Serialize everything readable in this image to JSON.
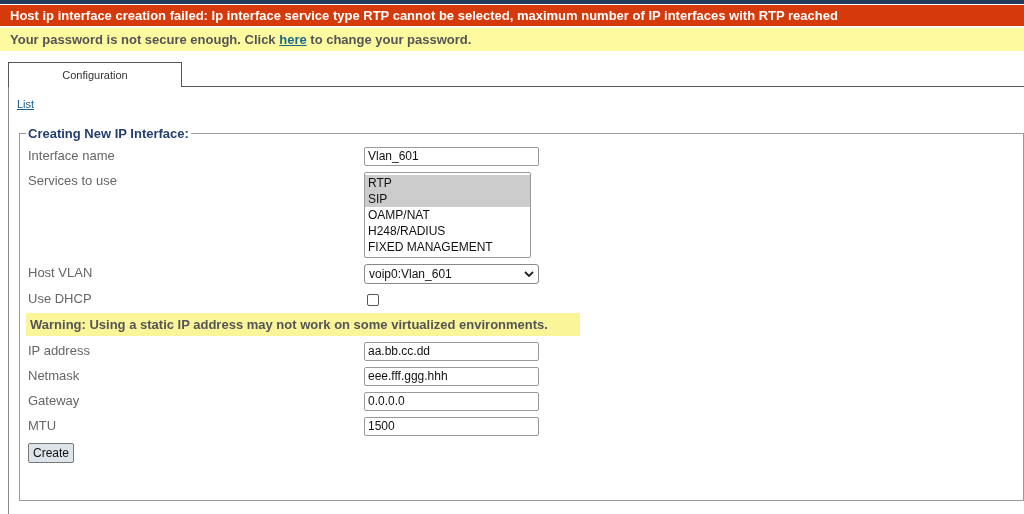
{
  "error_banner": "Host ip interface creation failed: Ip interface service type RTP cannot be selected, maximum number of IP interfaces with RTP reached",
  "password_notice": {
    "before": "Your password is not secure enough. Click ",
    "link": "here",
    "after": " to change your password."
  },
  "tabs": [
    {
      "label": "Configuration",
      "selected": true
    }
  ],
  "list_link": "List",
  "form": {
    "legend": "Creating New IP Interface:",
    "fields": [
      {
        "kind": "text",
        "label": "Interface name",
        "value": "Vlan_601"
      },
      {
        "kind": "listbox",
        "label": "Services to use",
        "options": [
          {
            "label": "RTP",
            "selected": true
          },
          {
            "label": "SIP",
            "selected": true
          },
          {
            "label": "OAMP/NAT",
            "selected": false
          },
          {
            "label": "H248/RADIUS",
            "selected": false
          },
          {
            "label": "FIXED MANAGEMENT",
            "selected": false
          }
        ]
      },
      {
        "kind": "select",
        "label": "Host VLAN",
        "value": "voip0:Vlan_601"
      },
      {
        "kind": "checkbox",
        "label": "Use DHCP",
        "checked": false
      },
      {
        "kind": "warning",
        "text": "Warning: Using a static IP address may not work on some virtualized environments."
      },
      {
        "kind": "text",
        "label": "IP address",
        "value": "aa.bb.cc.dd"
      },
      {
        "kind": "text",
        "label": "Netmask",
        "value": "eee.fff.ggg.hhh"
      },
      {
        "kind": "text",
        "label": "Gateway",
        "value": "0.0.0.0"
      },
      {
        "kind": "text",
        "label": "MTU",
        "value": "1500"
      }
    ],
    "submit": "Create"
  }
}
